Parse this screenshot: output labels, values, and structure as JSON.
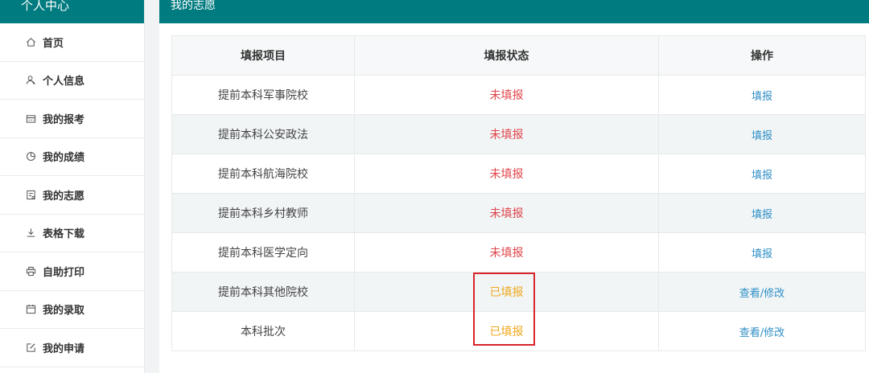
{
  "sidebar": {
    "title": "个人中心",
    "items": [
      {
        "label": "首页",
        "icon": "home-icon"
      },
      {
        "label": "个人信息",
        "icon": "user-icon"
      },
      {
        "label": "我的报考",
        "icon": "calendar-card-icon"
      },
      {
        "label": "我的成绩",
        "icon": "pie-chart-icon"
      },
      {
        "label": "我的志愿",
        "icon": "document-icon"
      },
      {
        "label": "表格下载",
        "icon": "download-icon"
      },
      {
        "label": "自助打印",
        "icon": "printer-icon"
      },
      {
        "label": "我的录取",
        "icon": "calendar-icon"
      },
      {
        "label": "我的申请",
        "icon": "edit-icon"
      }
    ]
  },
  "main": {
    "title": "我的志愿",
    "table": {
      "headers": [
        "填报项目",
        "填报状态",
        "操作"
      ],
      "rows": [
        {
          "item": "提前本科军事院校",
          "status": "未填报",
          "action": "填报"
        },
        {
          "item": "提前本科公安政法",
          "status": "未填报",
          "action": "填报"
        },
        {
          "item": "提前本科航海院校",
          "status": "未填报",
          "action": "填报"
        },
        {
          "item": "提前本科乡村教师",
          "status": "未填报",
          "action": "填报"
        },
        {
          "item": "提前本科医学定向",
          "status": "未填报",
          "action": "填报"
        },
        {
          "item": "提前本科其他院校",
          "status": "已填报",
          "action": "查看/修改"
        },
        {
          "item": "本科批次",
          "status": "已填报",
          "action": "查看/修改"
        }
      ]
    }
  },
  "colors": {
    "header_bg": "#007b7f",
    "status_unfilled": "#e0454a",
    "status_filled": "#f0a81e",
    "action_link": "#2f8fc6",
    "highlight_box": "#d9252b"
  }
}
